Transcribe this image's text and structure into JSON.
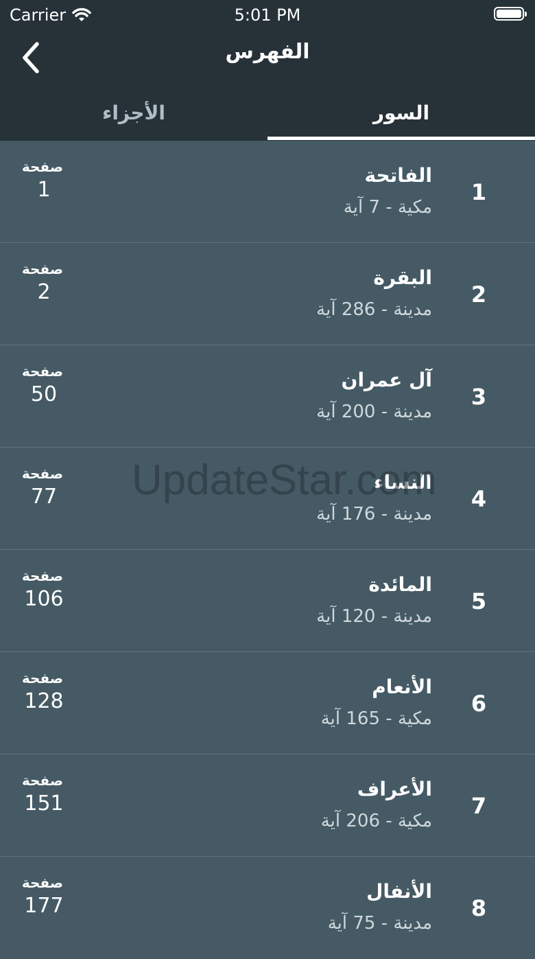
{
  "status_bar": {
    "carrier": "Carrier",
    "time": "5:01 PM"
  },
  "nav": {
    "title": "الفهرس",
    "back_icon": "chevron-left-icon"
  },
  "tabs": [
    {
      "label": "الأجزاء",
      "selected": false
    },
    {
      "label": "السور",
      "selected": true
    }
  ],
  "surahs": [
    {
      "number": "1",
      "name": "الفاتحة",
      "info": "مكية - 7 آية",
      "page_label": "صفحة",
      "page": "1"
    },
    {
      "number": "2",
      "name": "البقرة",
      "info": "مدينة - 286 آية",
      "page_label": "صفحة",
      "page": "2"
    },
    {
      "number": "3",
      "name": "آل عمران",
      "info": "مدينة - 200 آية",
      "page_label": "صفحة",
      "page": "50"
    },
    {
      "number": "4",
      "name": "النساء",
      "info": "مدينة - 176 آية",
      "page_label": "صفحة",
      "page": "77"
    },
    {
      "number": "5",
      "name": "المائدة",
      "info": "مدينة - 120 آية",
      "page_label": "صفحة",
      "page": "106"
    },
    {
      "number": "6",
      "name": "الأنعام",
      "info": "مكية - 165 آية",
      "page_label": "صفحة",
      "page": "128"
    },
    {
      "number": "7",
      "name": "الأعراف",
      "info": "مكية - 206 آية",
      "page_label": "صفحة",
      "page": "151"
    },
    {
      "number": "8",
      "name": "الأنفال",
      "info": "مدينة - 75 آية",
      "page_label": "صفحة",
      "page": "177"
    }
  ],
  "watermark": "UpdateStar.com",
  "colors": {
    "header": "#263238",
    "list_bg": "#455a64",
    "divider": "#5f7580",
    "text": "#ffffff",
    "muted": "#cfd8dc"
  }
}
